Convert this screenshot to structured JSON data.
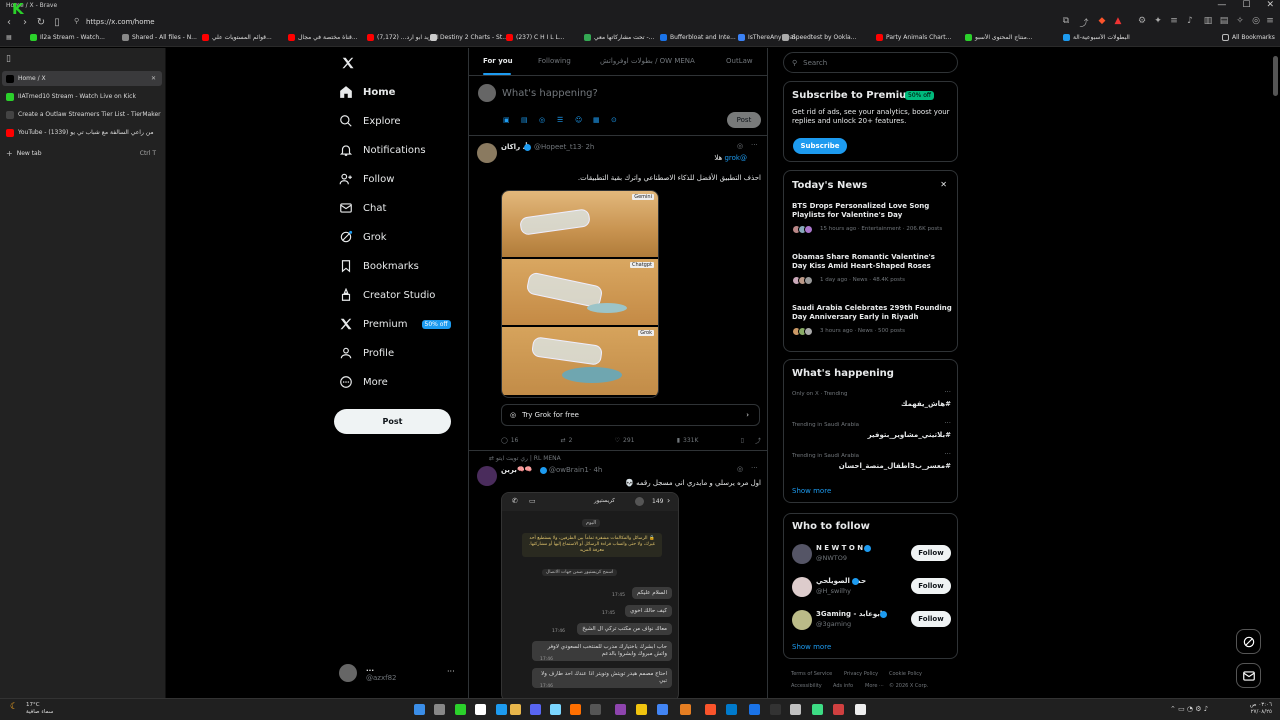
{
  "window": {
    "title": "Home / X - Brave",
    "logo_text": "Kick"
  },
  "address": {
    "url": "https://x.com/home"
  },
  "bookmarks": [
    {
      "label": "Il2a Stream - Watch...",
      "color": "#2bd12b"
    },
    {
      "label": "Shared - All files - N...",
      "color": "#888888"
    },
    {
      "label": "قوائم المستويات علي...",
      "color": "#ff0000"
    },
    {
      "label": "قناة مختصة في مجال...",
      "color": "#ff0000"
    },
    {
      "label": "الفريد ابو ارد... (7,172)",
      "color": "#ff0000"
    },
    {
      "label": "Destiny 2 Charts - St...",
      "color": "#cccccc"
    },
    {
      "label": "(237) C H I L L...",
      "color": "#ff0000"
    },
    {
      "label": "تحت مشاركاتها معي -...",
      "color": "#34a853"
    },
    {
      "label": "Bufferbloat and Inte...",
      "color": "#1a73e8"
    },
    {
      "label": "IsThereAnyDeal",
      "color": "#3b82f6"
    },
    {
      "label": "Speedtest by Ookla...",
      "color": "#aaaaaa"
    },
    {
      "label": "Party Animals Chart...",
      "color": "#ff0000"
    },
    {
      "label": "منتاج المحتوى الأسبو...",
      "color": "#2bd12b"
    },
    {
      "label": "البطولات الأسبوعية-الة",
      "color": "#1d9bf0"
    }
  ],
  "all_bookmarks": "All Bookmarks",
  "vertical_tabs": [
    {
      "label": "Home / X",
      "icon": "x-logo-icon",
      "color": "#000000",
      "active": true
    },
    {
      "label": "IIATmed10 Stream - Watch Live on Kick",
      "icon": "kick-icon",
      "color": "#2bd12b",
      "active": false
    },
    {
      "label": "Create a Outlaw Streamers Tier List - TierMaker",
      "icon": "tiermaker-icon",
      "color": "#444444",
      "active": false
    },
    {
      "label": "YouTube - من راعي السالفة مع شباب تي يو (1339)",
      "icon": "youtube-icon",
      "color": "#ff0000",
      "active": false
    }
  ],
  "new_tab": {
    "label": "New tab",
    "shortcut": "Ctrl T"
  },
  "nav": {
    "items": [
      "Home",
      "Explore",
      "Notifications",
      "Follow",
      "Chat",
      "Grok",
      "Bookmarks",
      "Creator Studio",
      "Premium",
      "Profile",
      "More"
    ],
    "premium_badge": "50% off",
    "post_label": "Post",
    "account_name": "...",
    "account_handle": "@azxf82"
  },
  "timeline": {
    "tabs": [
      "For you",
      "Following",
      "بطولات اوفرواتش / OW MENA",
      "OutLaw"
    ],
    "compose_placeholder": "What's happening?",
    "compose_post": "Post"
  },
  "tweet1": {
    "name": "أ. راكان",
    "handle": "@Hopeet_t13",
    "time": "· 2h",
    "reply_to_prefix": "هلا",
    "reply_to": "@grok",
    "text": "احذف التطبيق الأفضل للذكاء الاصطناعي واترك بقية التطبيقات.",
    "image_labels": [
      "Gemini",
      "Chatgpt",
      "Grok"
    ],
    "grok_cta": "Try Grok for free",
    "stats": {
      "replies": "16",
      "reposts": "2",
      "likes": "291",
      "views": "331K"
    }
  },
  "tweet2": {
    "context": "ري تويت ايتو | RL MENA",
    "name": "برين",
    "handle": "@owBrain1",
    "time": "· 4h",
    "text": "اول مره يرسلي و مايدري اني مسجل رقمه 💀",
    "chat": {
      "count": "149",
      "contact": "كريستيور",
      "day": "اليوم",
      "e2e_notice": "🔒 الرسائل والمكالمات مشفرة تماماً بين الطرفين، ولا يستطيع أحد غيرك، ولا حتى واتساب قراءة الرسائل أو الاستماع إليها أو مشاركتها. معرفة المزيد",
      "contact_notice": "اسمح كريستيور ضمن جهات الاتصال",
      "messages": [
        {
          "text": "السلام عليكم",
          "time": "17:45"
        },
        {
          "text": "كيف حالك اخوي",
          "time": "17:45"
        },
        {
          "text": "معاك نواف من مكتب تركي ال الشيخ",
          "time": "17:46"
        },
        {
          "text": "حاب ابشرك باختيارك مدرب للمنتخب السعودي لاوفر واتش مبروك وابشروا بالدعم",
          "time": "17:46"
        },
        {
          "text": "احتاج مصمم هيدر تويتش وتويتر اذا عندك احد طارف ولا تبي",
          "time": "17:46"
        }
      ]
    }
  },
  "right": {
    "search_placeholder": "Search",
    "premium": {
      "title": "Subscribe to Premium",
      "badge": "50% off",
      "body": "Get rid of ads, see your analytics, boost your replies and unlock 20+ features.",
      "button": "Subscribe"
    },
    "news": {
      "title": "Today's News",
      "items": [
        {
          "headline": "BTS Drops Personalized Love Song Playlists for Valentine's Day",
          "meta": "15 hours ago · Entertainment · 206.6K posts"
        },
        {
          "headline": "Obamas Share Romantic Valentine's Day Kiss Amid Heart-Shaped Roses",
          "meta": "1 day ago · News · 48.4K posts"
        },
        {
          "headline": "Saudi Arabia Celebrates 299th Founding Day Anniversary Early in Riyadh",
          "meta": "3 hours ago · News · 500 posts"
        }
      ]
    },
    "happening": {
      "title": "What's happening",
      "trends": [
        {
          "context": "Only on X · Trending",
          "name": "#هاش_يفهمك"
        },
        {
          "context": "Trending in Saudi Arabia",
          "name": "#بلاتيني_مشاوير_بتوفير"
        },
        {
          "context": "Trending in Saudi Arabia",
          "name": "#معسر_ب3اطفال_منصة_احسان"
        }
      ],
      "show_more": "Show more"
    },
    "who_to_follow": {
      "title": "Who to follow",
      "accounts": [
        {
          "name": "N E W T O N",
          "handle": "@NWTO9",
          "button": "Follow"
        },
        {
          "name": "حمد الصويلحي",
          "handle": "@H_swilhy",
          "button": "Follow"
        },
        {
          "name": "3Gaming - ابوعابد",
          "handle": "@3gaming",
          "button": "Follow"
        }
      ],
      "show_more": "Show more"
    },
    "footer": [
      "Terms of Service",
      "Privacy Policy",
      "Cookie Policy",
      "Accessibility",
      "Ads info",
      "More ···",
      "© 2026 X Corp."
    ]
  },
  "taskbar": {
    "weather_temp": "17°C",
    "weather_desc": "سماء صافية",
    "time": "٠٣:٠٦ ص",
    "date": "٢٧/٠٨/٢٥"
  }
}
